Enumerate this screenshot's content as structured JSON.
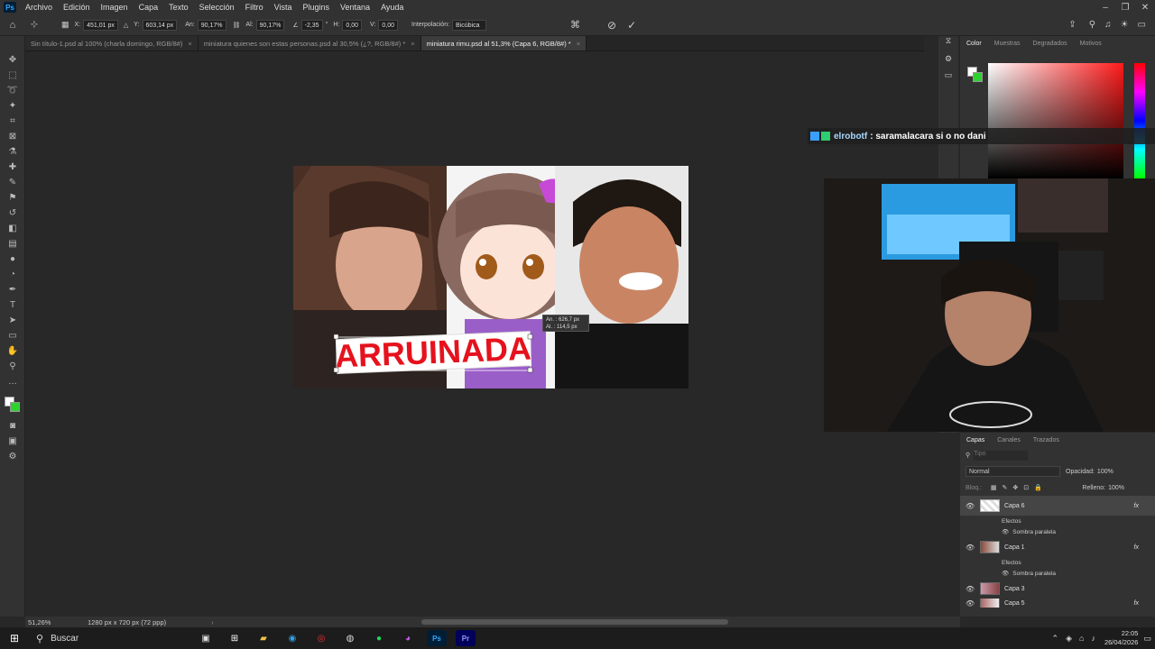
{
  "menu": {
    "logo": "Ps",
    "items": [
      "Archivo",
      "Edición",
      "Imagen",
      "Capa",
      "Texto",
      "Selección",
      "Filtro",
      "Vista",
      "Plugins",
      "Ventana",
      "Ayuda"
    ]
  },
  "options": {
    "x_label": "X:",
    "x_value": "451,01 px",
    "y_label": "Y:",
    "y_value": "603,14 px",
    "w_label": "An:",
    "w_value": "90,17%",
    "h_label": "Al:",
    "h_value": "90,17%",
    "angle_value": "-2,35",
    "hskew_label": "H:",
    "hskew_value": "0,00",
    "vskew_label": "V:",
    "vskew_value": "0,00",
    "interp_label": "Interpolación:",
    "interp_value": "Bicúbica"
  },
  "tabs": [
    {
      "label": "Sin título-1.psd al 100% (charla domingo, RGB/8#)",
      "close": "×"
    },
    {
      "label": "miniatura quienes son estas personas.psd al 30,5% (¿?, RGB/8#) *",
      "close": "×"
    },
    {
      "label": "miniatura rimu.psd al 51,3% (Capa 6, RGB/8#) *",
      "close": "×"
    }
  ],
  "canvas": {
    "headline": "ARRUINADA",
    "transform_w": "An. : 626,7 px",
    "transform_h": "Al. : 114,5 px"
  },
  "color_panel": {
    "tabs": [
      "Color",
      "Muestras",
      "Degradados",
      "Motivos"
    ]
  },
  "chat": {
    "user": "elrobotf",
    "message": ": saramalacara si o no dani"
  },
  "layers_panel": {
    "tabs": [
      "Capas",
      "Canales",
      "Trazados"
    ],
    "search_placeholder": "Tipo",
    "blend_mode": "Normal",
    "opacity_label": "Opacidad:",
    "opacity_value": "100%",
    "lock_label": "Bloq.:",
    "fill_label": "Relleno:",
    "fill_value": "100%",
    "layers": [
      {
        "name": "Capa 6",
        "effects": "Efectos",
        "effect": "Sombra paralela",
        "fx": "fx"
      },
      {
        "name": "Capa 1",
        "effects": "Efectos",
        "effect": "Sombra paralela",
        "fx": "fx"
      },
      {
        "name": "Capa 3"
      },
      {
        "name": "Capa 5",
        "fx": "fx"
      }
    ]
  },
  "status": {
    "zoom": "51,26%",
    "doc_info": "1280 px x 720 px (72 ppp)"
  },
  "taskbar": {
    "search": "Buscar",
    "time": "22:05",
    "date": "26/04/2026"
  }
}
